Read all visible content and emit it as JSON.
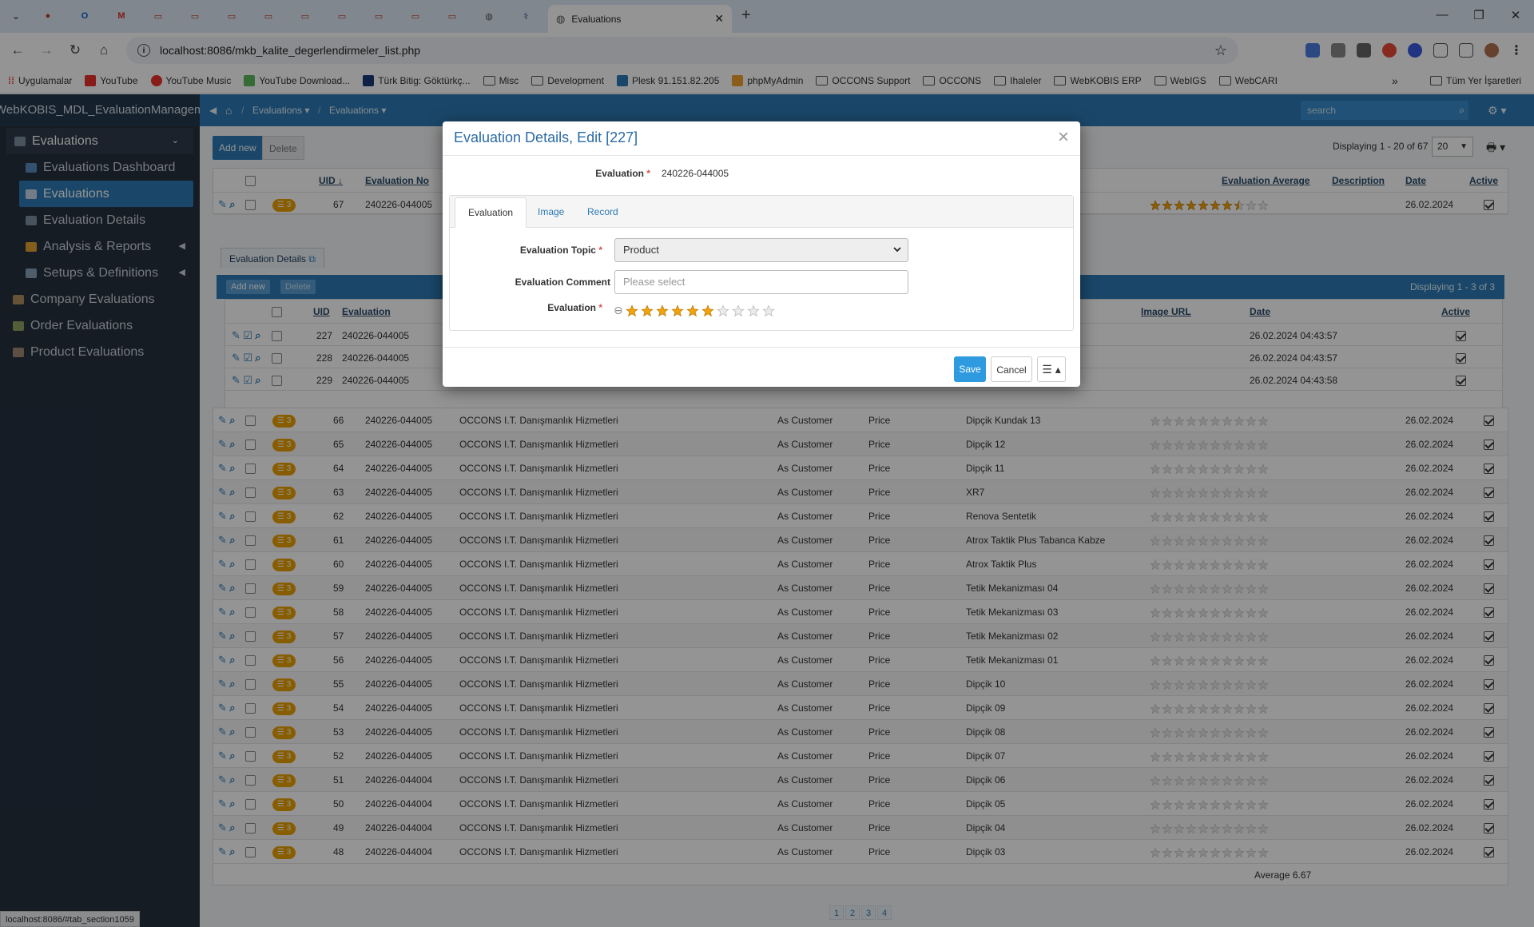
{
  "browser": {
    "active_tab_title": "Evaluations",
    "url": "localhost:8086/mkb_kalite_degerlendirmeler_list.php",
    "bookmarks": [
      "Uygulamalar",
      "YouTube",
      "YouTube Music",
      "YouTube Download...",
      "Türk Bitig: Göktürkç...",
      "Misc",
      "Development",
      "Plesk 91.151.82.205",
      "phpMyAdmin",
      "OCCONS Support",
      "OCCONS",
      "Ihaleler",
      "WebKOBIS ERP",
      "WebIGS",
      "WebCARI"
    ],
    "all_bookmarks": "Tüm Yer İşaretleri",
    "status_url": "localhost:8086/#tab_section1059"
  },
  "app": {
    "brand": "WebKOBIS_MDL_EvaluationManagement",
    "breadcrumb": [
      "Evaluations",
      "Evaluations"
    ],
    "search_placeholder": "search"
  },
  "sidebar": {
    "parent": "Evaluations",
    "children": [
      "Evaluations Dashboard",
      "Evaluations",
      "Evaluation Details",
      "Analysis & Reports",
      "Setups & Definitions"
    ],
    "others": [
      "Company Evaluations",
      "Order Evaluations",
      "Product Evaluations"
    ]
  },
  "toolbar": {
    "add_new": "Add new",
    "delete": "Delete",
    "displaying": "Displaying 1 - 20 of 67",
    "page_size": "20"
  },
  "master_headers": {
    "uid": "UID",
    "eval_no": "Evaluation No",
    "avg": "Evaluation Average",
    "desc": "Description",
    "date": "Date",
    "active": "Active"
  },
  "first_row": {
    "uid": "67",
    "no": "240226-044005",
    "date": "26.02.2024",
    "badge": "3",
    "rating": 7.5
  },
  "detail": {
    "tab": "Evaluation Details",
    "add_new": "Add new",
    "delete": "Delete",
    "displaying": "Displaying 1 - 3 of 3",
    "headers": {
      "uid": "UID",
      "evaluation": "Evaluation",
      "image_url": "Image URL",
      "date": "Date",
      "active": "Active"
    },
    "rows": [
      {
        "uid": "227",
        "evaluation": "240226-044005",
        "date": "26.02.2024 04:43:57"
      },
      {
        "uid": "228",
        "evaluation": "240226-044005",
        "date": "26.02.2024 04:43:57"
      },
      {
        "uid": "229",
        "evaluation": "240226-044005",
        "date": "26.02.2024 04:43:58"
      }
    ]
  },
  "rows": [
    {
      "uid": "66",
      "no": "240226-044005",
      "company": "OCCONS I.T. Danışmanlık Hizmetleri",
      "role": "As Customer",
      "topic": "Price",
      "product": "Dipçik Kundak 13",
      "date": "26.02.2024",
      "badge": "3"
    },
    {
      "uid": "65",
      "no": "240226-044005",
      "company": "OCCONS I.T. Danışmanlık Hizmetleri",
      "role": "As Customer",
      "topic": "Price",
      "product": "Dipçik 12",
      "date": "26.02.2024",
      "badge": "3"
    },
    {
      "uid": "64",
      "no": "240226-044005",
      "company": "OCCONS I.T. Danışmanlık Hizmetleri",
      "role": "As Customer",
      "topic": "Price",
      "product": "Dipçik 11",
      "date": "26.02.2024",
      "badge": "3"
    },
    {
      "uid": "63",
      "no": "240226-044005",
      "company": "OCCONS I.T. Danışmanlık Hizmetleri",
      "role": "As Customer",
      "topic": "Price",
      "product": "XR7",
      "date": "26.02.2024",
      "badge": "3"
    },
    {
      "uid": "62",
      "no": "240226-044005",
      "company": "OCCONS I.T. Danışmanlık Hizmetleri",
      "role": "As Customer",
      "topic": "Price",
      "product": "Renova Sentetik",
      "date": "26.02.2024",
      "badge": "3"
    },
    {
      "uid": "61",
      "no": "240226-044005",
      "company": "OCCONS I.T. Danışmanlık Hizmetleri",
      "role": "As Customer",
      "topic": "Price",
      "product": "Atrox Taktik Plus Tabanca Kabze",
      "date": "26.02.2024",
      "badge": "3"
    },
    {
      "uid": "60",
      "no": "240226-044005",
      "company": "OCCONS I.T. Danışmanlık Hizmetleri",
      "role": "As Customer",
      "topic": "Price",
      "product": "Atrox Taktik Plus",
      "date": "26.02.2024",
      "badge": "3"
    },
    {
      "uid": "59",
      "no": "240226-044005",
      "company": "OCCONS I.T. Danışmanlık Hizmetleri",
      "role": "As Customer",
      "topic": "Price",
      "product": "Tetik Mekanizması 04",
      "date": "26.02.2024",
      "badge": "3"
    },
    {
      "uid": "58",
      "no": "240226-044005",
      "company": "OCCONS I.T. Danışmanlık Hizmetleri",
      "role": "As Customer",
      "topic": "Price",
      "product": "Tetik Mekanizması 03",
      "date": "26.02.2024",
      "badge": "3"
    },
    {
      "uid": "57",
      "no": "240226-044005",
      "company": "OCCONS I.T. Danışmanlık Hizmetleri",
      "role": "As Customer",
      "topic": "Price",
      "product": "Tetik Mekanizması 02",
      "date": "26.02.2024",
      "badge": "3"
    },
    {
      "uid": "56",
      "no": "240226-044005",
      "company": "OCCONS I.T. Danışmanlık Hizmetleri",
      "role": "As Customer",
      "topic": "Price",
      "product": "Tetik Mekanizması 01",
      "date": "26.02.2024",
      "badge": "3"
    },
    {
      "uid": "55",
      "no": "240226-044005",
      "company": "OCCONS I.T. Danışmanlık Hizmetleri",
      "role": "As Customer",
      "topic": "Price",
      "product": "Dipçik 10",
      "date": "26.02.2024",
      "badge": "3"
    },
    {
      "uid": "54",
      "no": "240226-044005",
      "company": "OCCONS I.T. Danışmanlık Hizmetleri",
      "role": "As Customer",
      "topic": "Price",
      "product": "Dipçik 09",
      "date": "26.02.2024",
      "badge": "3"
    },
    {
      "uid": "53",
      "no": "240226-044005",
      "company": "OCCONS I.T. Danışmanlık Hizmetleri",
      "role": "As Customer",
      "topic": "Price",
      "product": "Dipçik 08",
      "date": "26.02.2024",
      "badge": "3"
    },
    {
      "uid": "52",
      "no": "240226-044005",
      "company": "OCCONS I.T. Danışmanlık Hizmetleri",
      "role": "As Customer",
      "topic": "Price",
      "product": "Dipçik 07",
      "date": "26.02.2024",
      "badge": "3"
    },
    {
      "uid": "51",
      "no": "240226-044004",
      "company": "OCCONS I.T. Danışmanlık Hizmetleri",
      "role": "As Customer",
      "topic": "Price",
      "product": "Dipçik 06",
      "date": "26.02.2024",
      "badge": "3"
    },
    {
      "uid": "50",
      "no": "240226-044004",
      "company": "OCCONS I.T. Danışmanlık Hizmetleri",
      "role": "As Customer",
      "topic": "Price",
      "product": "Dipçik 05",
      "date": "26.02.2024",
      "badge": "3"
    },
    {
      "uid": "49",
      "no": "240226-044004",
      "company": "OCCONS I.T. Danışmanlık Hizmetleri",
      "role": "As Customer",
      "topic": "Price",
      "product": "Dipçik 04",
      "date": "26.02.2024",
      "badge": "3"
    },
    {
      "uid": "48",
      "no": "240226-044004",
      "company": "OCCONS I.T. Danışmanlık Hizmetleri",
      "role": "As Customer",
      "topic": "Price",
      "product": "Dipçik 03",
      "date": "26.02.2024",
      "badge": "3"
    }
  ],
  "average": "Average 6.67",
  "pages": [
    "1",
    "2",
    "3",
    "4"
  ],
  "modal": {
    "title": "Evaluation Details, Edit [227]",
    "evaluation_label": "Evaluation",
    "evaluation_value": "240226-044005",
    "tabs": [
      "Evaluation",
      "Image",
      "Record"
    ],
    "topic_label": "Evaluation Topic",
    "topic_value": "Product",
    "comment_label": "Evaluation Comment",
    "comment_placeholder": "Please select",
    "rating_label": "Evaluation",
    "rating_value": 6,
    "rating_max": 10,
    "save": "Save",
    "cancel": "Cancel"
  },
  "colors": {
    "primary": "#2e7bb6",
    "sidebar": "#26313f",
    "star": "#f0a30a",
    "badge": "#e8a000"
  }
}
